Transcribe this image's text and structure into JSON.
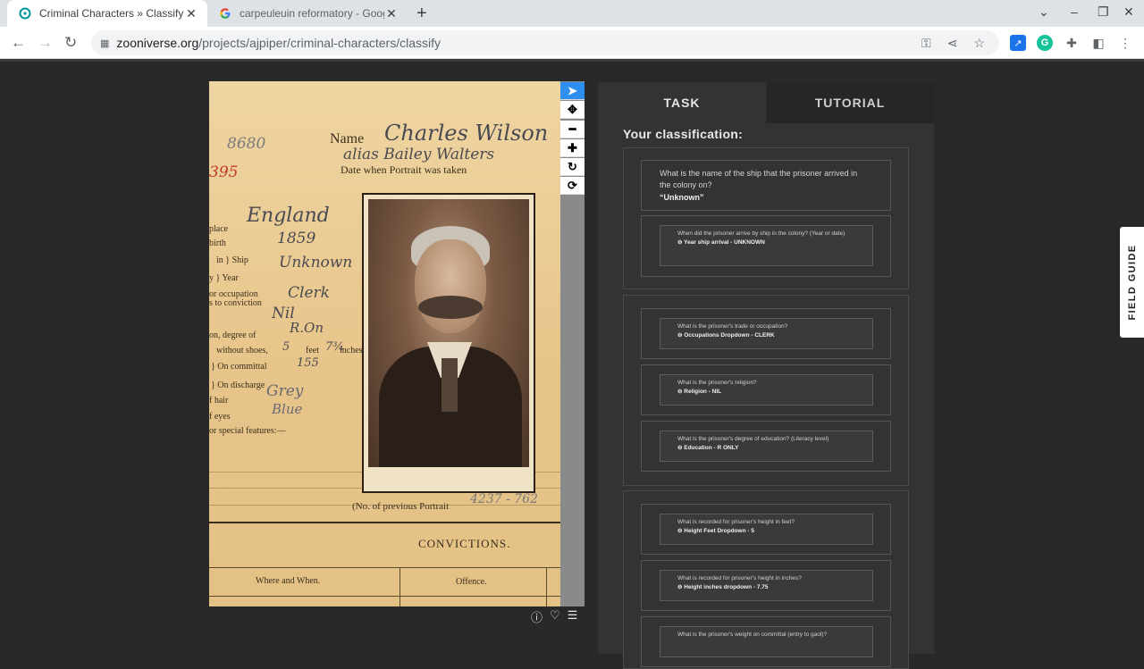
{
  "browser": {
    "tabs": [
      {
        "title": "Criminal Characters » Classify",
        "favicon": "zooniverse-icon",
        "active": true
      },
      {
        "title": "carpeuleuin reformatory - Google",
        "favicon": "google-icon",
        "active": false
      }
    ],
    "new_tab": "+",
    "url_domain": "zooniverse.org",
    "url_path": "/projects/ajpiper/criminal-characters/classify"
  },
  "subject": {
    "printed": {
      "name": "Name",
      "date_portrait": "Date when Portrait was taken",
      "place": "place",
      "birth": "birth",
      "ship": "in } Ship",
      "year": "y } Year",
      "occupation": "or occupation",
      "to_conviction": "s to conviction",
      "degree": "on, degree of",
      "without_shoes": "without shoes,",
      "feet": "feet",
      "inches": "inches",
      "on_committal": "} On committal",
      "on_discharge": "} On discharge",
      "hair": "f hair",
      "eyes": "f eyes",
      "special": "or special features:—",
      "prev_portrait": "(No. of previous Portrait",
      "convictions": "CONVICTIONS.",
      "where_when": "Where and When.",
      "offence": "Offence."
    },
    "handwritten": {
      "number": "8680",
      "red_number": "395",
      "name": "Charles Wilson",
      "alias": "alias Bailey Walters",
      "place": "England",
      "birth": "1859",
      "ship": "Unknown",
      "occupation": "Clerk",
      "religion": "Nil",
      "education": "R.On",
      "feet": "5",
      "inches": "7¾",
      "committal": "155",
      "hair": "Grey",
      "eyes": "Blue",
      "prev_portrait": "4237 - 762"
    }
  },
  "viewer_tools": [
    "pointer-icon",
    "move-icon",
    "zoom-out-icon",
    "zoom-in-icon",
    "rotate-icon",
    "reset-icon"
  ],
  "panel": {
    "tabs": {
      "task": "TASK",
      "tutorial": "TUTORIAL"
    },
    "heading": "Your classification:",
    "ship_question": "What is the name of the ship that the prisoner arrived in the colony on?",
    "ship_answer": "“Unknown”",
    "year_question": "When did the prisoner arrive by ship in the colony? (Year or date)",
    "year_answer": "⊖ Year ship arrival - UNKNOWN",
    "occ_question": "What is the prisoner's trade or occupation?",
    "occ_answer": "⊖ Occupations Dropdown - CLERK",
    "rel_question": "What is the prisoner's religion?",
    "rel_answer": "⊖ Religion - NIL",
    "edu_question": "What is the prisoner's degree of education? (Literacy level)",
    "edu_answer": "⊖ Education - R ONLY",
    "feet_question": "What is recorded for prisoner's height in feet?",
    "feet_answer": "⊖ Height Feet Dropdown - 5",
    "inch_question": "What is recorded for prisoner's height in inches?",
    "inch_answer": "⊖ Height inches dropdown - 7.75",
    "weight_question": "What is the prisoner's weight on committal (entry to gaol)?"
  },
  "field_guide": "FIELD GUIDE"
}
